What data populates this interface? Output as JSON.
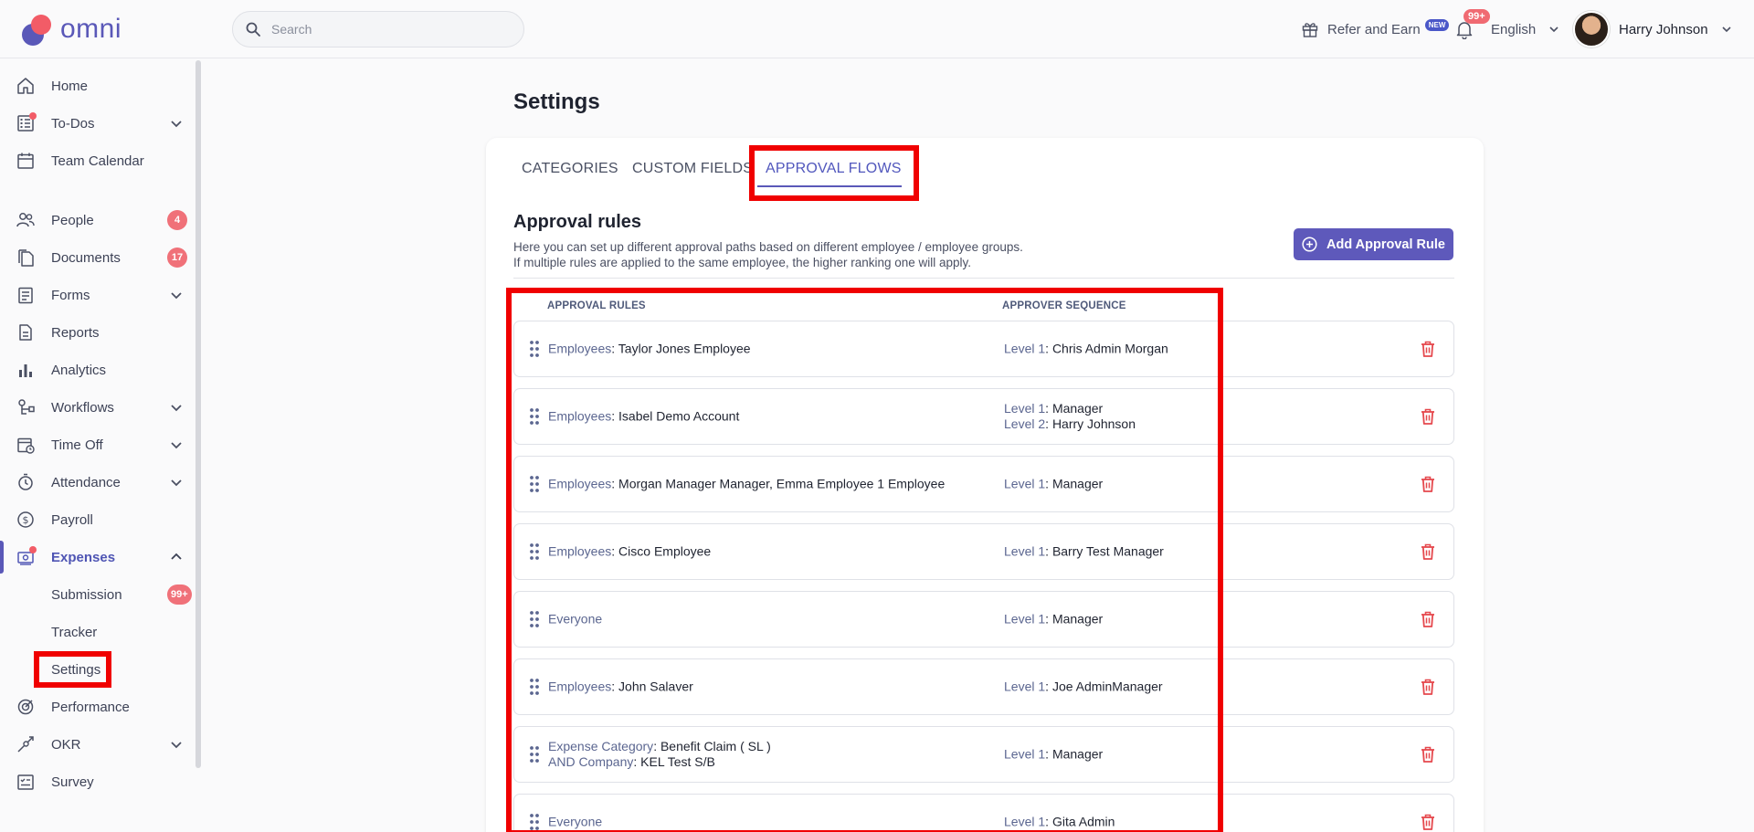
{
  "header": {
    "logo_text": "omni",
    "search_placeholder": "Search",
    "refer_label": "Refer and Earn",
    "refer_badge": "NEW",
    "notifications_badge": "99+",
    "language": "English",
    "user_name": "Harry Johnson"
  },
  "sidebar": {
    "items": [
      {
        "label": "Home",
        "icon": "home-icon"
      },
      {
        "label": "To-Dos",
        "icon": "todo-icon"
      },
      {
        "label": "Team Calendar",
        "icon": "calendar-icon"
      },
      {
        "label": "People",
        "icon": "people-icon",
        "count": "4"
      },
      {
        "label": "Documents",
        "icon": "documents-icon",
        "count": "17"
      },
      {
        "label": "Forms",
        "icon": "forms-icon"
      },
      {
        "label": "Reports",
        "icon": "reports-icon"
      },
      {
        "label": "Analytics",
        "icon": "analytics-icon"
      },
      {
        "label": "Workflows",
        "icon": "workflows-icon"
      },
      {
        "label": "Time Off",
        "icon": "time-off-icon"
      },
      {
        "label": "Attendance",
        "icon": "attendance-icon"
      },
      {
        "label": "Payroll",
        "icon": "payroll-icon"
      },
      {
        "label": "Expenses",
        "icon": "expenses-icon"
      },
      {
        "label": "Submission",
        "count": "99+"
      },
      {
        "label": "Tracker"
      },
      {
        "label": "Settings"
      },
      {
        "label": "Performance",
        "icon": "performance-icon"
      },
      {
        "label": "OKR",
        "icon": "okr-icon"
      },
      {
        "label": "Survey",
        "icon": "survey-icon"
      }
    ]
  },
  "page": {
    "title": "Settings",
    "tabs": [
      "CATEGORIES",
      "CUSTOM FIELDS",
      "APPROVAL FLOWS"
    ],
    "active_tab": "APPROVAL FLOWS",
    "section_title": "Approval rules",
    "description_1": "Here you can set up different approval paths based on different employee / employee groups.",
    "description_2": "If multiple rules are applied to the same employee, the higher ranking one will apply.",
    "add_button": "Add Approval Rule",
    "col_rules": "APPROVAL RULES",
    "col_sequence": "APPROVER SEQUENCE"
  },
  "rules": [
    {
      "rule": [
        {
          "key": "Employees",
          "value": "Taylor Jones Employee"
        }
      ],
      "sequence": [
        {
          "key": "Level 1",
          "value": "Chris Admin Morgan"
        }
      ]
    },
    {
      "rule": [
        {
          "key": "Employees",
          "value": "Isabel Demo Account"
        }
      ],
      "sequence": [
        {
          "key": "Level 1",
          "value": "Manager"
        },
        {
          "key": "Level 2",
          "value": "Harry Johnson"
        }
      ]
    },
    {
      "rule": [
        {
          "key": "Employees",
          "value": "Morgan Manager Manager, Emma Employee 1 Employee"
        }
      ],
      "sequence": [
        {
          "key": "Level 1",
          "value": "Manager"
        }
      ]
    },
    {
      "rule": [
        {
          "key": "Employees",
          "value": "Cisco Employee"
        }
      ],
      "sequence": [
        {
          "key": "Level 1",
          "value": "Barry Test Manager"
        }
      ]
    },
    {
      "rule": [
        {
          "key": "Everyone",
          "value": ""
        }
      ],
      "sequence": [
        {
          "key": "Level 1",
          "value": "Manager"
        }
      ]
    },
    {
      "rule": [
        {
          "key": "Employees",
          "value": "John Salaver"
        }
      ],
      "sequence": [
        {
          "key": "Level 1",
          "value": "Joe AdminManager"
        }
      ]
    },
    {
      "rule": [
        {
          "key": "Expense Category",
          "value": "Benefit Claim ( SL )"
        },
        {
          "key": "AND Company",
          "value": "KEL Test S/B"
        }
      ],
      "sequence": [
        {
          "key": "Level 1",
          "value": "Manager"
        }
      ]
    },
    {
      "rule": [
        {
          "key": "Everyone",
          "value": ""
        }
      ],
      "sequence": [
        {
          "key": "Level 1",
          "value": "Gita Admin"
        }
      ]
    }
  ],
  "colors": {
    "accent": "#5a58b8",
    "badge": "#f07179",
    "highlight": "#f00000",
    "delete": "#e5484d"
  }
}
